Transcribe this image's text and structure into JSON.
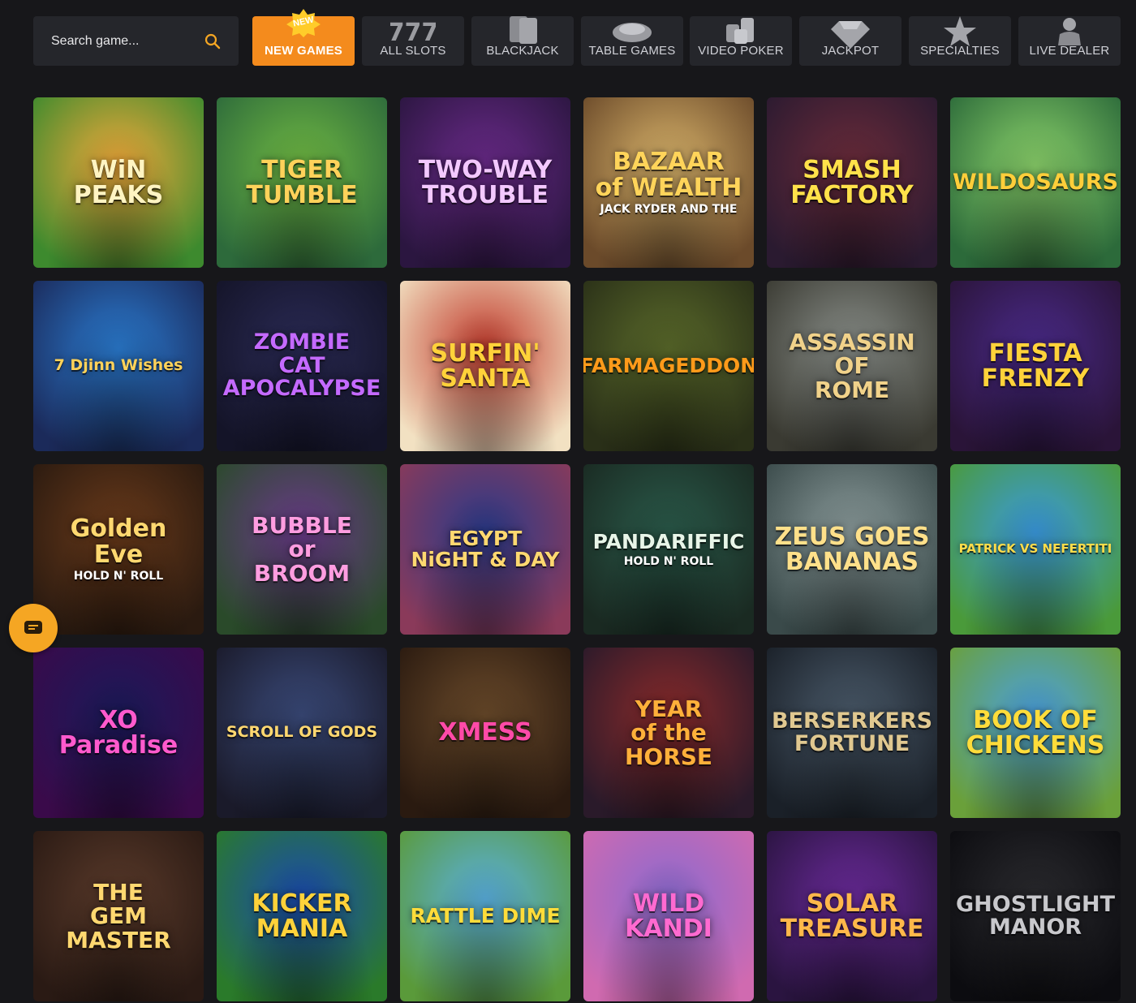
{
  "search": {
    "placeholder": "Search game..."
  },
  "tabs": [
    {
      "label": "NEW GAMES",
      "badge": "NEW",
      "icon": "new-badge-icon",
      "active": true
    },
    {
      "label": "ALL SLOTS",
      "icon": "slot-777-icon"
    },
    {
      "label": "BLACKJACK",
      "icon": "cards-icon"
    },
    {
      "label": "TABLE GAMES",
      "icon": "roulette-wheel-icon"
    },
    {
      "label": "VIDEO POKER",
      "icon": "chip-stack-icon"
    },
    {
      "label": "JACKPOT",
      "icon": "diamond-icon"
    },
    {
      "label": "SPECIALTIES",
      "icon": "star-icon"
    },
    {
      "label": "LIVE DEALER",
      "icon": "dealer-icon"
    }
  ],
  "games": [
    {
      "title": "WiN\nPEAKS",
      "bg1": "#f2a93a",
      "bg2": "#3d8a2e",
      "color": "#fff4c2"
    },
    {
      "title": "TIGER\nTUMBLE",
      "bg1": "#6fb842",
      "bg2": "#2d6a3b",
      "color": "#ffd25a"
    },
    {
      "title": "TWO-WAY\nTROUBLE",
      "bg1": "#6a2a8a",
      "bg2": "#2b1640",
      "color": "#f3c8ff"
    },
    {
      "title": "BAZAAR\nof WEALTH",
      "subtitle": "JACK RYDER AND THE",
      "bg1": "#d8b36a",
      "bg2": "#6b4a2a",
      "color": "#ffd45a"
    },
    {
      "title": "SMASH\nFACTORY",
      "bg1": "#6b2b3a",
      "bg2": "#2a1a30",
      "color": "#ffe14a"
    },
    {
      "title": "WILDOSAURS",
      "bg1": "#8ad16a",
      "bg2": "#2c6a3a",
      "color": "#ffce3a"
    },
    {
      "title": "7 Djinn Wishes",
      "bg1": "#2a7bd0",
      "bg2": "#1b2a5a",
      "color": "#ffd25a"
    },
    {
      "title": "ZOMBIE\nCAT\nAPOCALYPSE",
      "bg1": "#2a2a55",
      "bg2": "#141428",
      "color": "#c46aff"
    },
    {
      "title": "SURFIN'\nSANTA",
      "bg1": "#c0392b",
      "bg2": "#f2e1c2",
      "color": "#ffd23a"
    },
    {
      "title": "FARMAGEDDON",
      "bg1": "#5a6a2a",
      "bg2": "#2a3018",
      "color": "#ff9a1a"
    },
    {
      "title": "ASSASSIN\nOF\nROME",
      "bg1": "#8a8f8a",
      "bg2": "#3a3a32",
      "color": "#f1d28a"
    },
    {
      "title": "FIESTA\nFRENZY",
      "bg1": "#4a2a8a",
      "bg2": "#2a1438",
      "color": "#ffd23a"
    },
    {
      "title": "Golden\nEve",
      "subtitle": "HOLD N' ROLL",
      "bg1": "#6a3a1a",
      "bg2": "#2a1a10",
      "color": "#ffd870"
    },
    {
      "title": "BUBBLE\nor\nBROOM",
      "bg1": "#6a3a8a",
      "bg2": "#2a4a2a",
      "color": "#ff9de0"
    },
    {
      "title": "EGYPT\nNiGHT & DAY",
      "bg1": "#2a3a8a",
      "bg2": "#8a3a5a",
      "color": "#ffd870"
    },
    {
      "title": "PANDARIFFIC",
      "subtitle": "HOLD N' ROLL",
      "bg1": "#2a5a4a",
      "bg2": "#1a2a22",
      "color": "#e8f5e8"
    },
    {
      "title": "ZEUS GOES\nBANANAS",
      "bg1": "#8a9a9a",
      "bg2": "#3a4a4a",
      "color": "#ffe08a"
    },
    {
      "title": "PATRICK VS NEFERTITI",
      "bg1": "#3a9ae0",
      "bg2": "#4a9a3a",
      "color": "#ffdc4a"
    },
    {
      "title": "XO\nParadise",
      "bg1": "#1a1a5a",
      "bg2": "#3a0a4a",
      "color": "#ff5acd"
    },
    {
      "title": "SCROLL OF GODS",
      "bg1": "#3a4a7a",
      "bg2": "#1a1a2a",
      "color": "#ffd870"
    },
    {
      "title": "XMESS",
      "bg1": "#6a4a2a",
      "bg2": "#2a1a10",
      "color": "#ff4aa8"
    },
    {
      "title": "YEAR\nof the\nHORSE",
      "bg1": "#8a2a2a",
      "bg2": "#2a1a2a",
      "color": "#ffb03a"
    },
    {
      "title": "BERSERKERS\nFORTUNE",
      "bg1": "#4a5a6a",
      "bg2": "#1a2028",
      "color": "#e0c890"
    },
    {
      "title": "BOOK OF\nCHICKENS",
      "bg1": "#4aa0e0",
      "bg2": "#6aa03a",
      "color": "#ffdc3a"
    },
    {
      "title": "THE\nGEM\nMASTER",
      "bg1": "#5a3a2a",
      "bg2": "#2a1a14",
      "color": "#ffd870"
    },
    {
      "title": "KICKER\nMANIA",
      "bg1": "#1a4ab0",
      "bg2": "#2a7a2a",
      "color": "#ffd23a"
    },
    {
      "title": "RATTLE DIME",
      "bg1": "#5ab0e0",
      "bg2": "#5a9a3a",
      "color": "#ffdc3a"
    },
    {
      "title": "WILD\nKANDI",
      "bg1": "#8a6ad0",
      "bg2": "#d06ab0",
      "color": "#ff6ad0"
    },
    {
      "title": "SOLAR\nTREASURE",
      "bg1": "#6a2a9a",
      "bg2": "#2a1440",
      "color": "#ffb84a"
    },
    {
      "title": "GHOSTLIGHT\nMANOR",
      "bg1": "#2a2a2e",
      "bg2": "#0c0c10",
      "color": "#c8c8cc"
    }
  ]
}
